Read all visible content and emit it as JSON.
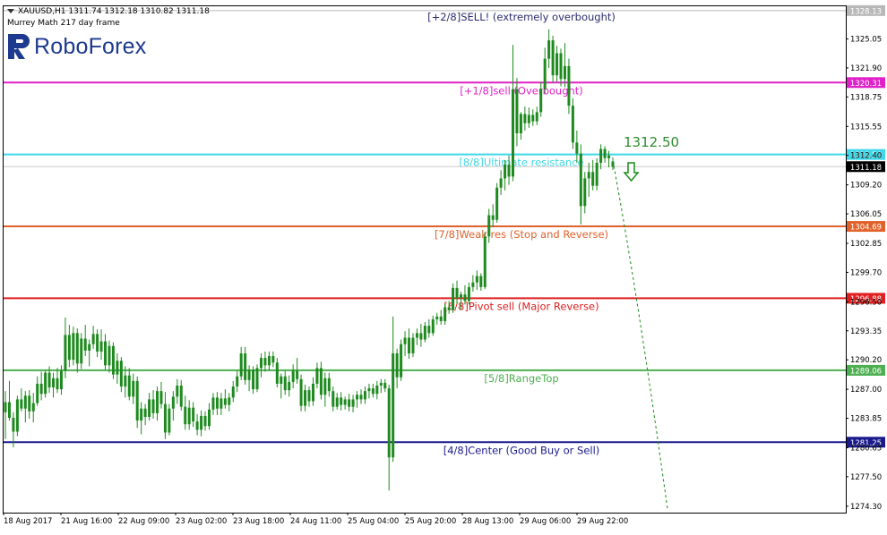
{
  "header": {
    "symbol_line": "XAUUSD,H1  1311.74 1312.18 1310.82 1311.18",
    "indicator_line": "Murrey Math 217 day frame"
  },
  "logo": {
    "text": "RoboForex",
    "color": "#1d3a8f"
  },
  "chart_data": {
    "type": "candlestick",
    "symbol": "XAUUSD",
    "timeframe": "H1",
    "ohlc_last": {
      "open": 1311.74,
      "high": 1312.18,
      "low": 1310.82,
      "close": 1311.18
    },
    "ylim": [
      1273.6,
      1328.6
    ],
    "y_ticks": [
      1325.05,
      1321.9,
      1318.75,
      1315.55,
      1312.4,
      1309.2,
      1306.05,
      1302.85,
      1299.7,
      1296.5,
      1293.35,
      1290.2,
      1287.0,
      1283.85,
      1280.65,
      1277.5,
      1274.3
    ],
    "x_ticks": [
      "18 Aug 2017",
      "21 Aug 16:00",
      "22 Aug 09:00",
      "23 Aug 02:00",
      "23 Aug 18:00",
      "24 Aug 11:00",
      "25 Aug 04:00",
      "25 Aug 20:00",
      "28 Aug 13:00",
      "29 Aug 06:00",
      "29 Aug 22:00"
    ],
    "current_price": {
      "value": 1311.18,
      "label": "1311.18"
    },
    "levels": [
      {
        "value": 1328.13,
        "label": "[+2/8]SELL! (extremely overbought)",
        "tag": "1328.13",
        "color": "#b8b8b8",
        "text_color": "#2d2d6e"
      },
      {
        "value": 1320.31,
        "label": "[+1/8]sell (Overbought)",
        "tag": "1320.31",
        "color": "#e020c8",
        "text_color": "#e020c8"
      },
      {
        "value": 1312.5,
        "label": "[8/8]Ultimate resistance",
        "tag": "1312.50",
        "color": "#3ed8e8",
        "text_color": "#3ed8e8"
      },
      {
        "value": 1304.69,
        "label": "[7/8]Weak res (Stop and Reverse)",
        "tag": "1304.69",
        "color": "#e0622a",
        "text_color": "#e0622a"
      },
      {
        "value": 1296.88,
        "label": "[6/8]Pivot sell (Major Reverse)",
        "tag": "1296.88",
        "color": "#e02020",
        "text_color": "#e02020"
      },
      {
        "value": 1289.06,
        "label": "[5/8]RangeTop",
        "tag": "1289.06",
        "color": "#4caf50",
        "text_color": "#4caf50"
      },
      {
        "value": 1281.25,
        "label": "[4/8]Center (Good Buy or Sell)",
        "tag": "1281.25",
        "color": "#1a1a8c",
        "text_color": "#1a1a8c"
      }
    ],
    "annotation": {
      "text": "1312.50",
      "color": "#2e8b2e"
    },
    "forecast": {
      "direction": "down",
      "from": 1311.8,
      "to": 1274.0,
      "color": "#1a8c1a"
    },
    "candles": [
      {
        "o": 1284.5,
        "h": 1286.8,
        "l": 1281.6,
        "c": 1285.6
      },
      {
        "o": 1285.6,
        "h": 1287.9,
        "l": 1283.6,
        "c": 1283.9
      },
      {
        "o": 1283.9,
        "h": 1284.5,
        "l": 1280.7,
        "c": 1282.4
      },
      {
        "o": 1282.4,
        "h": 1286.3,
        "l": 1281.9,
        "c": 1285.9
      },
      {
        "o": 1285.9,
        "h": 1287.1,
        "l": 1284.6,
        "c": 1284.9
      },
      {
        "o": 1284.9,
        "h": 1286.8,
        "l": 1283.4,
        "c": 1286.3
      },
      {
        "o": 1286.3,
        "h": 1286.9,
        "l": 1283.8,
        "c": 1284.6
      },
      {
        "o": 1284.6,
        "h": 1286.6,
        "l": 1283.4,
        "c": 1285.5
      },
      {
        "o": 1285.5,
        "h": 1288.4,
        "l": 1285.2,
        "c": 1287.6
      },
      {
        "o": 1287.6,
        "h": 1288.9,
        "l": 1285.8,
        "c": 1286.5
      },
      {
        "o": 1286.5,
        "h": 1289.0,
        "l": 1286.1,
        "c": 1288.8
      },
      {
        "o": 1288.8,
        "h": 1289.5,
        "l": 1286.6,
        "c": 1287.2
      },
      {
        "o": 1287.2,
        "h": 1288.8,
        "l": 1286.1,
        "c": 1288.2
      },
      {
        "o": 1288.2,
        "h": 1289.3,
        "l": 1286.6,
        "c": 1287.0
      },
      {
        "o": 1287.0,
        "h": 1289.6,
        "l": 1286.4,
        "c": 1289.0
      },
      {
        "o": 1289.0,
        "h": 1294.8,
        "l": 1288.2,
        "c": 1292.9
      },
      {
        "o": 1292.9,
        "h": 1294.0,
        "l": 1289.4,
        "c": 1290.2
      },
      {
        "o": 1290.2,
        "h": 1293.8,
        "l": 1289.6,
        "c": 1293.1
      },
      {
        "o": 1293.1,
        "h": 1293.6,
        "l": 1288.8,
        "c": 1289.8
      },
      {
        "o": 1289.8,
        "h": 1293.1,
        "l": 1289.2,
        "c": 1292.5
      },
      {
        "o": 1292.5,
        "h": 1294.0,
        "l": 1290.6,
        "c": 1291.2
      },
      {
        "o": 1291.2,
        "h": 1292.4,
        "l": 1289.5,
        "c": 1291.9
      },
      {
        "o": 1291.9,
        "h": 1293.9,
        "l": 1291.4,
        "c": 1293.0
      },
      {
        "o": 1293.0,
        "h": 1293.5,
        "l": 1290.5,
        "c": 1291.1
      },
      {
        "o": 1291.1,
        "h": 1293.5,
        "l": 1290.2,
        "c": 1292.2
      },
      {
        "o": 1292.2,
        "h": 1293.0,
        "l": 1289.1,
        "c": 1289.6
      },
      {
        "o": 1289.6,
        "h": 1292.3,
        "l": 1288.8,
        "c": 1291.7
      },
      {
        "o": 1291.7,
        "h": 1292.1,
        "l": 1288.1,
        "c": 1288.6
      },
      {
        "o": 1288.6,
        "h": 1290.9,
        "l": 1287.6,
        "c": 1290.1
      },
      {
        "o": 1290.1,
        "h": 1290.5,
        "l": 1286.7,
        "c": 1287.3
      },
      {
        "o": 1287.3,
        "h": 1289.5,
        "l": 1286.1,
        "c": 1288.5
      },
      {
        "o": 1288.5,
        "h": 1289.3,
        "l": 1285.8,
        "c": 1286.2
      },
      {
        "o": 1286.2,
        "h": 1288.7,
        "l": 1285.4,
        "c": 1287.9
      },
      {
        "o": 1287.9,
        "h": 1288.4,
        "l": 1282.8,
        "c": 1283.6
      },
      {
        "o": 1283.6,
        "h": 1285.6,
        "l": 1282.1,
        "c": 1284.9
      },
      {
        "o": 1284.9,
        "h": 1285.4,
        "l": 1283.1,
        "c": 1284.0
      },
      {
        "o": 1284.0,
        "h": 1286.6,
        "l": 1283.6,
        "c": 1285.9
      },
      {
        "o": 1285.9,
        "h": 1286.9,
        "l": 1283.8,
        "c": 1284.4
      },
      {
        "o": 1284.4,
        "h": 1287.3,
        "l": 1283.6,
        "c": 1286.8
      },
      {
        "o": 1286.8,
        "h": 1287.8,
        "l": 1284.9,
        "c": 1285.4
      },
      {
        "o": 1285.4,
        "h": 1286.7,
        "l": 1281.6,
        "c": 1282.3
      },
      {
        "o": 1282.3,
        "h": 1285.4,
        "l": 1282.0,
        "c": 1284.9
      },
      {
        "o": 1284.9,
        "h": 1286.8,
        "l": 1283.6,
        "c": 1286.2
      },
      {
        "o": 1286.2,
        "h": 1288.1,
        "l": 1285.4,
        "c": 1287.4
      },
      {
        "o": 1287.4,
        "h": 1288.0,
        "l": 1284.7,
        "c": 1285.1
      },
      {
        "o": 1285.1,
        "h": 1286.3,
        "l": 1282.6,
        "c": 1283.2
      },
      {
        "o": 1283.2,
        "h": 1285.8,
        "l": 1282.6,
        "c": 1285.0
      },
      {
        "o": 1285.0,
        "h": 1285.6,
        "l": 1282.9,
        "c": 1283.5
      },
      {
        "o": 1283.5,
        "h": 1284.3,
        "l": 1282.0,
        "c": 1282.6
      },
      {
        "o": 1282.6,
        "h": 1284.7,
        "l": 1281.9,
        "c": 1284.1
      },
      {
        "o": 1284.1,
        "h": 1284.6,
        "l": 1282.5,
        "c": 1283.0
      },
      {
        "o": 1283.0,
        "h": 1285.5,
        "l": 1282.6,
        "c": 1284.8
      },
      {
        "o": 1284.8,
        "h": 1286.6,
        "l": 1284.2,
        "c": 1286.1
      },
      {
        "o": 1286.1,
        "h": 1286.7,
        "l": 1284.2,
        "c": 1284.9
      },
      {
        "o": 1284.9,
        "h": 1286.6,
        "l": 1284.2,
        "c": 1286.0
      },
      {
        "o": 1286.0,
        "h": 1287.0,
        "l": 1284.9,
        "c": 1285.3
      },
      {
        "o": 1285.3,
        "h": 1286.6,
        "l": 1284.6,
        "c": 1286.1
      },
      {
        "o": 1286.1,
        "h": 1287.9,
        "l": 1285.6,
        "c": 1287.3
      },
      {
        "o": 1287.3,
        "h": 1289.0,
        "l": 1286.7,
        "c": 1288.4
      },
      {
        "o": 1288.4,
        "h": 1291.6,
        "l": 1288.0,
        "c": 1290.9
      },
      {
        "o": 1290.9,
        "h": 1291.6,
        "l": 1287.5,
        "c": 1288.0
      },
      {
        "o": 1288.0,
        "h": 1289.6,
        "l": 1286.8,
        "c": 1289.1
      },
      {
        "o": 1289.1,
        "h": 1289.5,
        "l": 1286.5,
        "c": 1287.0
      },
      {
        "o": 1287.0,
        "h": 1289.7,
        "l": 1286.7,
        "c": 1289.3
      },
      {
        "o": 1289.3,
        "h": 1290.9,
        "l": 1288.3,
        "c": 1290.4
      },
      {
        "o": 1290.4,
        "h": 1291.1,
        "l": 1288.9,
        "c": 1289.6
      },
      {
        "o": 1289.6,
        "h": 1291.1,
        "l": 1289.0,
        "c": 1290.6
      },
      {
        "o": 1290.6,
        "h": 1291.1,
        "l": 1289.4,
        "c": 1289.9
      },
      {
        "o": 1289.9,
        "h": 1290.4,
        "l": 1287.2,
        "c": 1287.6
      },
      {
        "o": 1287.6,
        "h": 1288.7,
        "l": 1286.0,
        "c": 1288.4
      },
      {
        "o": 1288.4,
        "h": 1289.0,
        "l": 1286.4,
        "c": 1286.9
      },
      {
        "o": 1286.9,
        "h": 1288.5,
        "l": 1286.2,
        "c": 1287.8
      },
      {
        "o": 1287.8,
        "h": 1289.7,
        "l": 1287.1,
        "c": 1289.0
      },
      {
        "o": 1289.0,
        "h": 1290.4,
        "l": 1287.6,
        "c": 1288.1
      },
      {
        "o": 1288.1,
        "h": 1288.6,
        "l": 1284.6,
        "c": 1285.2
      },
      {
        "o": 1285.2,
        "h": 1287.5,
        "l": 1284.6,
        "c": 1286.9
      },
      {
        "o": 1286.9,
        "h": 1287.3,
        "l": 1285.1,
        "c": 1285.7
      },
      {
        "o": 1285.7,
        "h": 1288.3,
        "l": 1285.2,
        "c": 1287.6
      },
      {
        "o": 1287.6,
        "h": 1289.9,
        "l": 1287.1,
        "c": 1289.3
      },
      {
        "o": 1289.3,
        "h": 1290.0,
        "l": 1285.9,
        "c": 1286.4
      },
      {
        "o": 1286.4,
        "h": 1288.8,
        "l": 1285.1,
        "c": 1288.2
      },
      {
        "o": 1288.2,
        "h": 1288.8,
        "l": 1286.2,
        "c": 1286.8
      },
      {
        "o": 1286.8,
        "h": 1287.3,
        "l": 1284.6,
        "c": 1285.1
      },
      {
        "o": 1285.1,
        "h": 1286.6,
        "l": 1284.8,
        "c": 1286.1
      },
      {
        "o": 1286.1,
        "h": 1286.7,
        "l": 1284.7,
        "c": 1285.3
      },
      {
        "o": 1285.3,
        "h": 1286.2,
        "l": 1284.8,
        "c": 1285.9
      },
      {
        "o": 1285.9,
        "h": 1286.5,
        "l": 1284.6,
        "c": 1285.1
      },
      {
        "o": 1285.1,
        "h": 1286.4,
        "l": 1284.5,
        "c": 1285.9
      },
      {
        "o": 1285.9,
        "h": 1286.8,
        "l": 1285.0,
        "c": 1286.4
      },
      {
        "o": 1286.4,
        "h": 1287.0,
        "l": 1285.4,
        "c": 1285.9
      },
      {
        "o": 1285.9,
        "h": 1287.3,
        "l": 1285.4,
        "c": 1286.8
      },
      {
        "o": 1286.8,
        "h": 1287.6,
        "l": 1286.0,
        "c": 1287.1
      },
      {
        "o": 1287.1,
        "h": 1287.6,
        "l": 1286.1,
        "c": 1286.5
      },
      {
        "o": 1286.5,
        "h": 1287.9,
        "l": 1285.9,
        "c": 1287.4
      },
      {
        "o": 1287.4,
        "h": 1288.1,
        "l": 1286.6,
        "c": 1287.7
      },
      {
        "o": 1287.7,
        "h": 1288.1,
        "l": 1286.7,
        "c": 1287.1
      },
      {
        "o": 1287.1,
        "h": 1287.5,
        "l": 1276.0,
        "c": 1279.6
      },
      {
        "o": 1279.6,
        "h": 1294.9,
        "l": 1279.1,
        "c": 1290.9
      },
      {
        "o": 1290.9,
        "h": 1291.4,
        "l": 1287.1,
        "c": 1288.3
      },
      {
        "o": 1288.3,
        "h": 1292.4,
        "l": 1287.9,
        "c": 1291.9
      },
      {
        "o": 1291.9,
        "h": 1293.3,
        "l": 1290.6,
        "c": 1292.6
      },
      {
        "o": 1292.6,
        "h": 1293.6,
        "l": 1290.3,
        "c": 1290.9
      },
      {
        "o": 1290.9,
        "h": 1293.1,
        "l": 1290.5,
        "c": 1292.6
      },
      {
        "o": 1292.6,
        "h": 1293.6,
        "l": 1291.8,
        "c": 1293.1
      },
      {
        "o": 1293.1,
        "h": 1294.1,
        "l": 1291.6,
        "c": 1292.4
      },
      {
        "o": 1292.4,
        "h": 1294.3,
        "l": 1292.1,
        "c": 1293.9
      },
      {
        "o": 1293.9,
        "h": 1294.6,
        "l": 1292.6,
        "c": 1293.1
      },
      {
        "o": 1293.1,
        "h": 1295.0,
        "l": 1292.8,
        "c": 1294.6
      },
      {
        "o": 1294.6,
        "h": 1295.3,
        "l": 1294.0,
        "c": 1294.9
      },
      {
        "o": 1294.9,
        "h": 1295.6,
        "l": 1294.0,
        "c": 1294.4
      },
      {
        "o": 1294.4,
        "h": 1296.3,
        "l": 1294.0,
        "c": 1295.9
      },
      {
        "o": 1295.9,
        "h": 1296.6,
        "l": 1295.2,
        "c": 1295.6
      },
      {
        "o": 1295.6,
        "h": 1298.5,
        "l": 1295.3,
        "c": 1298.0
      },
      {
        "o": 1298.0,
        "h": 1298.8,
        "l": 1296.3,
        "c": 1296.9
      },
      {
        "o": 1296.9,
        "h": 1297.6,
        "l": 1295.6,
        "c": 1297.3
      },
      {
        "o": 1297.3,
        "h": 1298.3,
        "l": 1296.2,
        "c": 1296.6
      },
      {
        "o": 1296.6,
        "h": 1298.6,
        "l": 1296.2,
        "c": 1298.1
      },
      {
        "o": 1298.1,
        "h": 1299.4,
        "l": 1297.6,
        "c": 1298.6
      },
      {
        "o": 1298.6,
        "h": 1299.9,
        "l": 1297.8,
        "c": 1299.3
      },
      {
        "o": 1299.3,
        "h": 1299.6,
        "l": 1297.7,
        "c": 1298.1
      },
      {
        "o": 1298.1,
        "h": 1304.1,
        "l": 1297.9,
        "c": 1303.6
      },
      {
        "o": 1303.6,
        "h": 1306.6,
        "l": 1302.9,
        "c": 1305.9
      },
      {
        "o": 1305.9,
        "h": 1307.1,
        "l": 1304.6,
        "c": 1305.4
      },
      {
        "o": 1305.4,
        "h": 1309.4,
        "l": 1305.1,
        "c": 1308.9
      },
      {
        "o": 1308.9,
        "h": 1310.8,
        "l": 1308.1,
        "c": 1309.9
      },
      {
        "o": 1309.9,
        "h": 1311.9,
        "l": 1308.6,
        "c": 1311.4
      },
      {
        "o": 1311.4,
        "h": 1312.4,
        "l": 1309.2,
        "c": 1310.1
      },
      {
        "o": 1310.1,
        "h": 1324.4,
        "l": 1309.6,
        "c": 1319.6
      },
      {
        "o": 1319.6,
        "h": 1320.8,
        "l": 1313.4,
        "c": 1314.8
      },
      {
        "o": 1314.8,
        "h": 1317.1,
        "l": 1314.1,
        "c": 1316.9
      },
      {
        "o": 1316.9,
        "h": 1317.7,
        "l": 1315.1,
        "c": 1315.9
      },
      {
        "o": 1315.9,
        "h": 1317.6,
        "l": 1315.4,
        "c": 1316.8
      },
      {
        "o": 1316.8,
        "h": 1317.4,
        "l": 1315.6,
        "c": 1316.1
      },
      {
        "o": 1316.1,
        "h": 1317.7,
        "l": 1315.7,
        "c": 1317.1
      },
      {
        "o": 1317.1,
        "h": 1320.4,
        "l": 1316.6,
        "c": 1319.6
      },
      {
        "o": 1319.6,
        "h": 1324.1,
        "l": 1319.1,
        "c": 1322.9
      },
      {
        "o": 1322.9,
        "h": 1326.1,
        "l": 1321.9,
        "c": 1324.9
      },
      {
        "o": 1324.9,
        "h": 1325.4,
        "l": 1320.3,
        "c": 1321.1
      },
      {
        "o": 1321.1,
        "h": 1324.3,
        "l": 1320.4,
        "c": 1323.5
      },
      {
        "o": 1323.5,
        "h": 1324.0,
        "l": 1319.9,
        "c": 1320.7
      },
      {
        "o": 1320.7,
        "h": 1324.6,
        "l": 1319.8,
        "c": 1322.1
      },
      {
        "o": 1322.1,
        "h": 1322.9,
        "l": 1316.9,
        "c": 1317.8
      },
      {
        "o": 1317.8,
        "h": 1318.6,
        "l": 1313.1,
        "c": 1313.8
      },
      {
        "o": 1313.8,
        "h": 1315.1,
        "l": 1311.6,
        "c": 1312.6
      },
      {
        "o": 1312.6,
        "h": 1313.6,
        "l": 1304.9,
        "c": 1306.9
      },
      {
        "o": 1306.9,
        "h": 1310.6,
        "l": 1306.1,
        "c": 1309.9
      },
      {
        "o": 1309.9,
        "h": 1311.6,
        "l": 1307.9,
        "c": 1310.6
      },
      {
        "o": 1310.6,
        "h": 1311.9,
        "l": 1308.6,
        "c": 1309.1
      },
      {
        "o": 1309.1,
        "h": 1312.1,
        "l": 1308.6,
        "c": 1311.6
      },
      {
        "o": 1311.6,
        "h": 1313.6,
        "l": 1310.9,
        "c": 1313.1
      },
      {
        "o": 1313.1,
        "h": 1313.4,
        "l": 1311.6,
        "c": 1312.1
      },
      {
        "o": 1312.1,
        "h": 1312.9,
        "l": 1311.1,
        "c": 1312.4
      },
      {
        "o": 1311.74,
        "h": 1312.18,
        "l": 1310.82,
        "c": 1311.18
      }
    ]
  }
}
